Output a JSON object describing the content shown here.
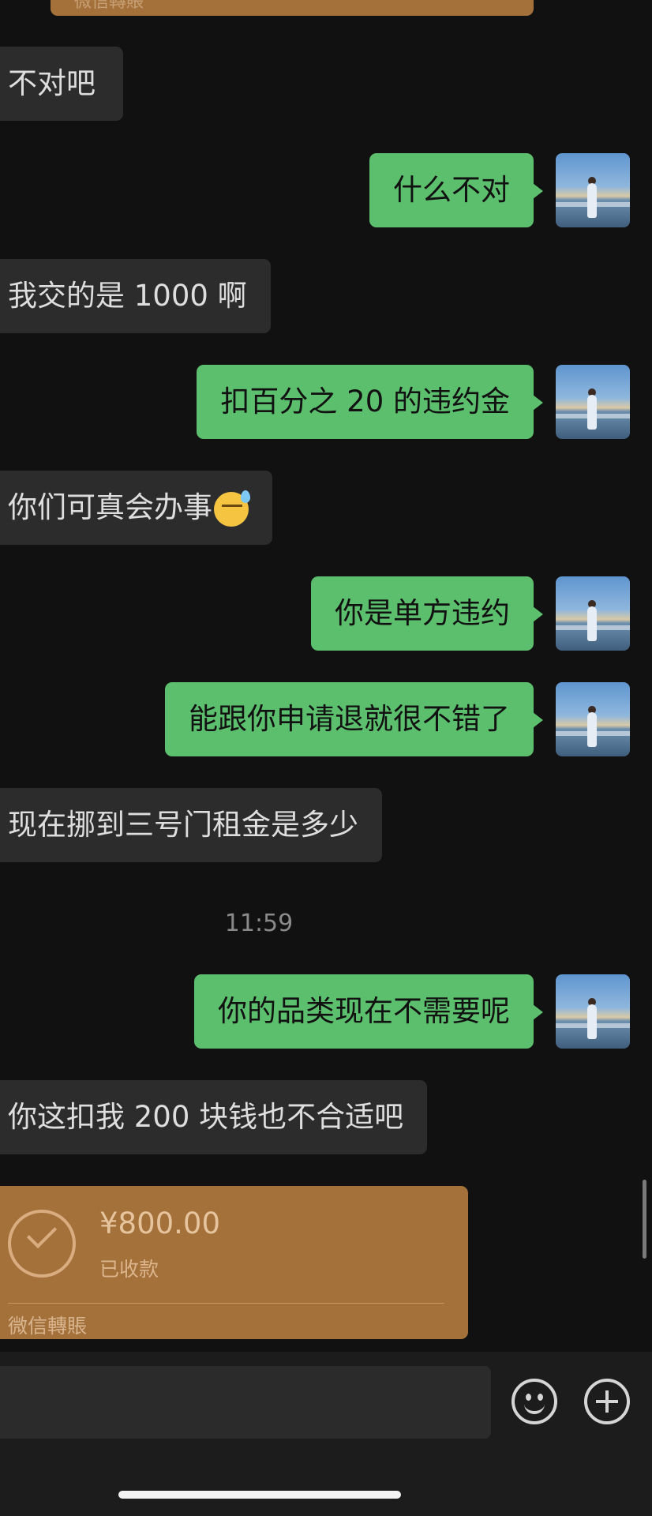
{
  "conversation": {
    "top_transfer_label": "微信轉賬",
    "messages": [
      {
        "side": "in",
        "text": "不对吧"
      },
      {
        "side": "out",
        "text": "什么不对"
      },
      {
        "side": "in",
        "text": "我交的是 1000 啊"
      },
      {
        "side": "out",
        "text": "扣百分之 20 的违约金"
      },
      {
        "side": "in",
        "text": "你们可真会办事",
        "emoji": "sweat-smile-emoji"
      },
      {
        "side": "out",
        "text": "你是单方违约"
      },
      {
        "side": "out",
        "text": "能跟你申请退就很不错了"
      },
      {
        "side": "in",
        "text": "现在挪到三号门租金是多少"
      },
      {
        "side": "out",
        "text": "你的品类现在不需要呢"
      },
      {
        "side": "in",
        "text": "你这扣我 200 块钱也不合适吧"
      }
    ],
    "timestamp": "11:59",
    "transfer": {
      "amount": "¥800.00",
      "status": "已收款",
      "brand": "微信轉賬",
      "icon": "check-circle-icon"
    }
  },
  "input_bar": {
    "emoji_icon": "emoji-icon",
    "plus_icon": "plus-icon"
  },
  "colors": {
    "background": "#111111",
    "incoming_bubble": "#2c2c2c",
    "outgoing_bubble": "#5cbf6d",
    "transfer_card": "#a4713b"
  }
}
